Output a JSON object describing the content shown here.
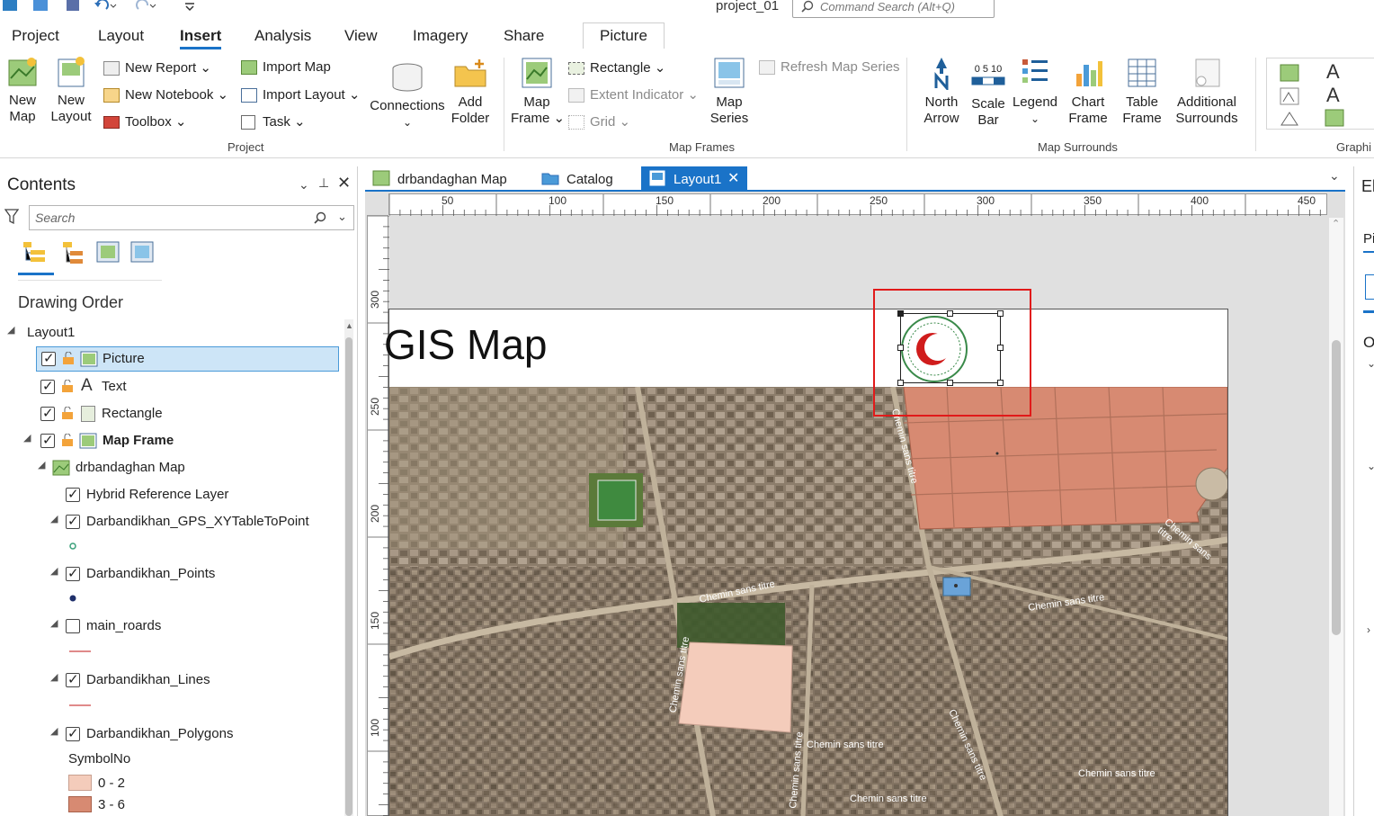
{
  "app": {
    "project_name": "project_01",
    "command_search_placeholder": "Command Search (Alt+Q)"
  },
  "tabs": [
    "Project",
    "Layout",
    "Insert",
    "Analysis",
    "View",
    "Imagery",
    "Share",
    "Picture"
  ],
  "active_tab": "Insert",
  "ribbon": {
    "project_group": {
      "label": "Project",
      "new_map": "New\nMap",
      "new_layout": "New\nLayout",
      "new_report": "New Report",
      "new_notebook": "New Notebook",
      "toolbox": "Toolbox",
      "import_map": "Import Map",
      "import_layout": "Import Layout",
      "task": "Task",
      "connections": "Connections",
      "add_folder": "Add\nFolder"
    },
    "map_frames_group": {
      "label": "Map Frames",
      "map_frame": "Map\nFrame",
      "rectangle": "Rectangle",
      "extent_indicator": "Extent Indicator",
      "grid": "Grid",
      "map_series": "Map\nSeries",
      "refresh_map_series": "Refresh Map Series"
    },
    "map_surrounds_group": {
      "label": "Map Surrounds",
      "north_arrow": "North\nArrow",
      "scale_bar": "Scale\nBar",
      "scale_bar_ticks": "0  5  10",
      "legend": "Legend",
      "chart_frame": "Chart\nFrame",
      "table_frame": "Table\nFrame",
      "additional_surrounds": "Additional\nSurrounds"
    },
    "graphics_group": {
      "label": "Graphi"
    }
  },
  "contents": {
    "title": "Contents",
    "search_placeholder": "Search",
    "drawing_order_label": "Drawing Order",
    "tree": [
      {
        "label": "Layout1",
        "level": 0
      },
      {
        "label": "Picture",
        "level": 1,
        "checked": true,
        "selected": true
      },
      {
        "label": "Text",
        "level": 1,
        "checked": true
      },
      {
        "label": "Rectangle",
        "level": 1,
        "checked": true
      },
      {
        "label": "Map Frame",
        "level": 1,
        "checked": true,
        "bold": true
      },
      {
        "label": "drbandaghan Map",
        "level": 2
      },
      {
        "label": "Hybrid Reference Layer",
        "level": 3,
        "checked": true
      },
      {
        "label": "Darbandikhan_GPS_XYTableToPoint",
        "level": 3,
        "checked": true
      },
      {
        "label": "Darbandikhan_Points",
        "level": 3,
        "checked": true
      },
      {
        "label": "main_roards",
        "level": 3,
        "checked": false
      },
      {
        "label": "Darbandikhan_Lines",
        "level": 3,
        "checked": true
      },
      {
        "label": "Darbandikhan_Polygons",
        "level": 3,
        "checked": true
      }
    ],
    "legend_field": "SymbolNo",
    "legend_classes": [
      {
        "label": "0 - 2",
        "color": "#f4ccbb"
      },
      {
        "label": "3 - 6",
        "color": "#d78a72"
      }
    ]
  },
  "doc_tabs": [
    {
      "label": "drbandaghan Map"
    },
    {
      "label": "Catalog"
    },
    {
      "label": "Layout1",
      "active": true
    }
  ],
  "layout": {
    "title_text": "GIS Map",
    "ruler_top_ticks": [
      "50",
      "100",
      "150",
      "200",
      "250",
      "300",
      "350",
      "400",
      "450"
    ],
    "ruler_left_ticks": [
      "300",
      "250",
      "200",
      "150",
      "100"
    ],
    "road_labels": [
      "Chemin sans titre",
      "Chemin sans titre",
      "Chemin sans titre",
      "Chemin sans titre",
      "Chemin sans titre",
      "Chemin sans titre",
      "Chemin sans titre",
      "Chemin sans titre",
      "Chemin sans titre",
      "Chemin sans titre"
    ]
  },
  "right_panel": {
    "header": "El",
    "tab": "Pi",
    "section": "O"
  },
  "colors": {
    "accent": "#1a73c8",
    "selection_red": "#e11a1a",
    "polygon_light": "#f4ccbb",
    "polygon_dark": "#d78a72"
  }
}
